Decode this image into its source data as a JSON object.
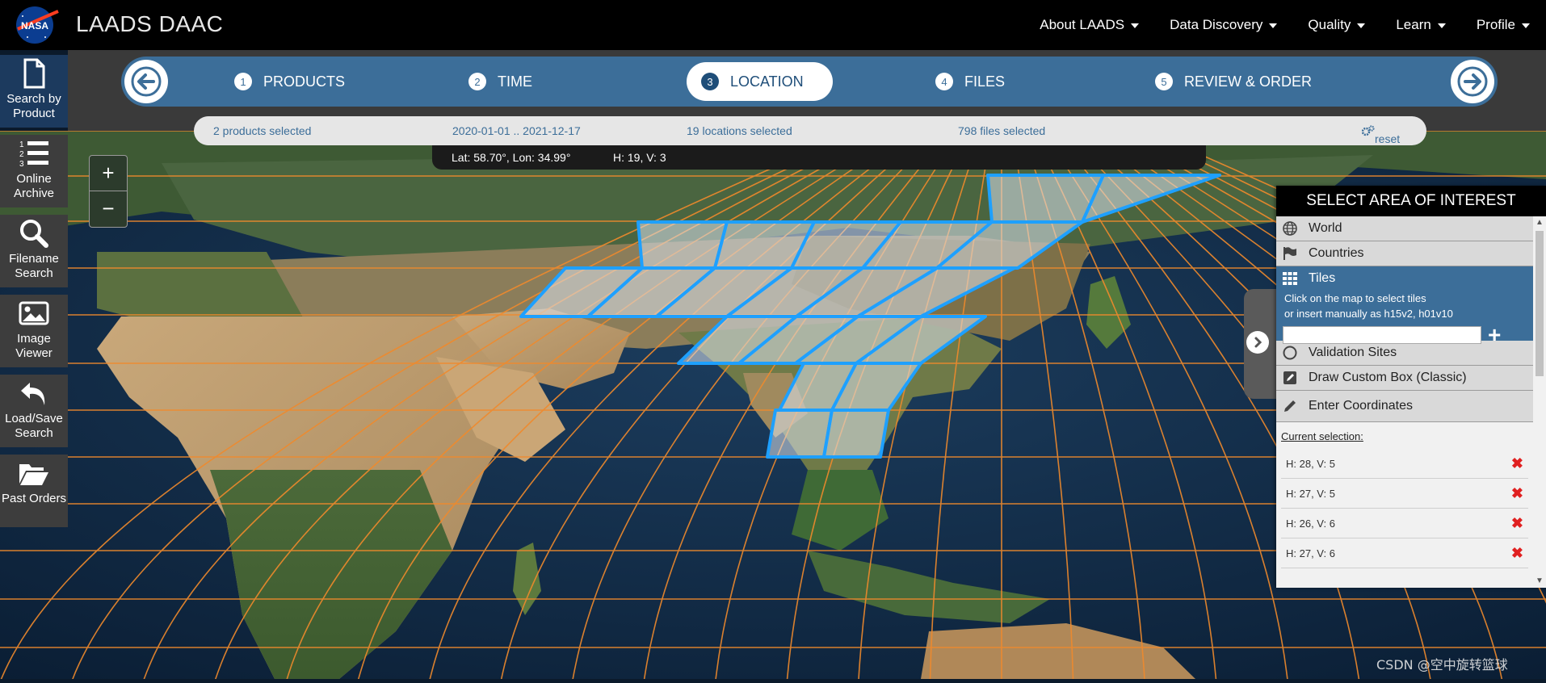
{
  "app": {
    "title": "LAADS DAAC"
  },
  "topnav": [
    {
      "label": "About LAADS"
    },
    {
      "label": "Data Discovery"
    },
    {
      "label": "Quality"
    },
    {
      "label": "Learn"
    },
    {
      "label": "Profile"
    }
  ],
  "sidebar": {
    "items": [
      {
        "label_line1": "Search by",
        "label_line2": "Product",
        "icon": "file-icon",
        "active": true
      },
      {
        "label_line1": "Online",
        "label_line2": "Archive",
        "icon": "list-numbered-icon"
      },
      {
        "label_line1": "Filename",
        "label_line2": "Search",
        "icon": "search-icon"
      },
      {
        "label_line1": "Image",
        "label_line2": "Viewer",
        "icon": "image-icon"
      },
      {
        "label_line1": "Load/Save",
        "label_line2": "Search",
        "icon": "undo-icon"
      },
      {
        "label_line1": "Past Orders",
        "label_line2": "",
        "icon": "folder-open-icon"
      }
    ]
  },
  "stepper": {
    "steps": [
      {
        "num": "1",
        "label": "PRODUCTS"
      },
      {
        "num": "2",
        "label": "TIME"
      },
      {
        "num": "3",
        "label": "LOCATION",
        "active": true
      },
      {
        "num": "4",
        "label": "FILES"
      },
      {
        "num": "5",
        "label": "REVIEW & ORDER"
      }
    ]
  },
  "summary": {
    "products": "2 products selected",
    "dates": "2020-01-01 .. 2021-12-17",
    "locations": "19 locations selected",
    "files": "798 files selected",
    "reset": "reset"
  },
  "coords": {
    "latlon": "Lat: 58.70°, Lon: 34.99°",
    "tile": "H: 19, V: 3"
  },
  "zoom": {
    "in": "+",
    "out": "−"
  },
  "panel": {
    "title": "SELECT AREA OF INTEREST",
    "options": {
      "world": "World",
      "countries": "Countries",
      "tiles": "Tiles",
      "validation": "Validation Sites",
      "custom_box": "Draw Custom Box (Classic)",
      "coordinates": "Enter Coordinates"
    },
    "tiles_help_1": "Click on the map to select tiles",
    "tiles_help_2": "or insert manually as h15v2, h01v10",
    "tiles_input_value": "",
    "current_selection_label": "Current selection:",
    "current_selection": [
      "H: 28, V: 5",
      "H: 27, V: 5",
      "H: 26, V: 6",
      "H: 27, V: 6"
    ]
  },
  "watermark": "CSDN @空中旋转篮球",
  "colors": {
    "stepper": "#3c6e99",
    "grid": "#f08a2c",
    "tile_outline": "#1ea0ff",
    "remove": "#e02020"
  }
}
